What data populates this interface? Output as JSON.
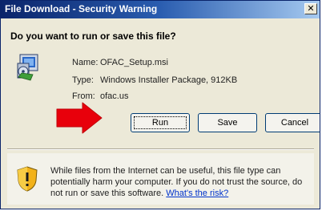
{
  "window": {
    "title": "File Download - Security Warning",
    "close_glyph": "✕"
  },
  "heading": "Do you want to run or save this file?",
  "file": {
    "icon": "installer-package-icon",
    "name_label": "Name:",
    "name_value": "OFAC_Setup.msi",
    "type_label": "Type:",
    "type_value": "Windows Installer Package, 912KB",
    "from_label": "From:",
    "from_value": "ofac.us"
  },
  "annotation": {
    "icon": "red-arrow-icon",
    "color": "#e8000b"
  },
  "buttons": {
    "run_label": "Run",
    "save_label": "Save",
    "cancel_label": "Cancel"
  },
  "warning": {
    "icon": "shield-warning-icon",
    "text": "While files from the Internet can be useful, this file type can potentially harm your computer. If you do not trust the source, do not run or save this software.",
    "link": "What's the risk?"
  },
  "colors": {
    "titlebar_start": "#0a246a",
    "titlebar_end": "#a6caf0",
    "window_bg": "#ece9d8",
    "link": "#0033cc"
  }
}
